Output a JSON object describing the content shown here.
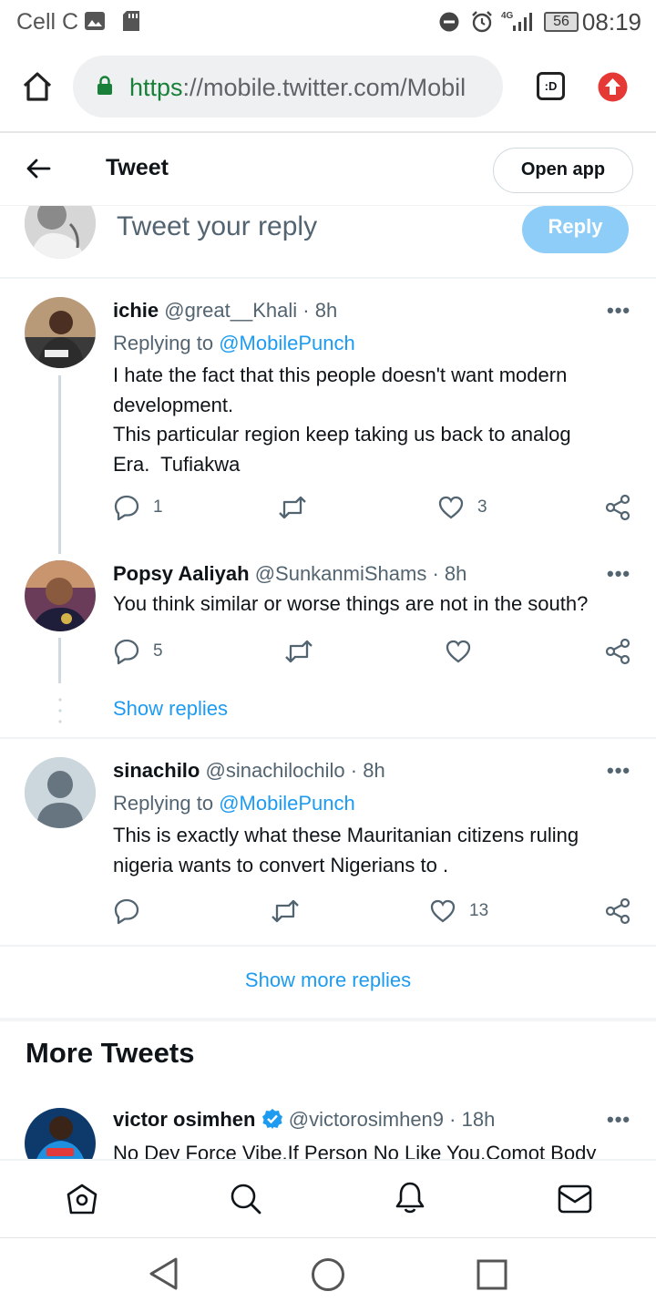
{
  "status_bar": {
    "carrier": "Cell C",
    "network": "4G",
    "battery": "56",
    "time": "08:19"
  },
  "browser": {
    "url_scheme": "https",
    "url_rest": "://mobile.twitter.com/Mobil",
    "tab_count": ":D"
  },
  "header": {
    "title": "Tweet",
    "open_app": "Open app"
  },
  "reply_box": {
    "placeholder": "Tweet your reply",
    "button": "Reply"
  },
  "replies": [
    {
      "name": "ichie",
      "handle": "@great__Khali",
      "time": "· 8h",
      "replying_prefix": "Replying to ",
      "replying_to": "@MobilePunch",
      "text_lines": [
        "I hate the fact that this people doesn't want modern",
        "development.",
        "This particular region keep taking us back to analog",
        "Era.  Tufiakwa"
      ],
      "replies": "1",
      "retweets": "",
      "likes": "3"
    },
    {
      "name": "Popsy Aaliyah",
      "handle": "@SunkanmiShams",
      "time": "· 8h",
      "text_lines": [
        "You think similar or worse things are not in the south?"
      ],
      "replies": "5",
      "retweets": "",
      "likes": ""
    },
    {
      "name": "sinachilo",
      "handle": "@sinachilochilo",
      "time": "· 8h",
      "replying_prefix": "Replying to ",
      "replying_to": "@MobilePunch",
      "text_lines": [
        "This is exactly what these Mauritanian citizens ruling",
        "nigeria wants to convert Nigerians to ."
      ],
      "replies": "",
      "retweets": "",
      "likes": "13"
    }
  ],
  "show_replies": "Show replies",
  "show_more_replies": "Show more replies",
  "more_tweets": {
    "title": "More Tweets",
    "tweet": {
      "name": "victor osimhen",
      "handle": "@victorosimhen9",
      "time": "· 18h",
      "text": "No Dey Force Vibe.If Person No Like You.Comot Body"
    }
  },
  "more_icon": "•••",
  "colors": {
    "accent": "#1d9bf0",
    "reply_button": "#8ecdf8",
    "text_secondary": "#536471"
  }
}
